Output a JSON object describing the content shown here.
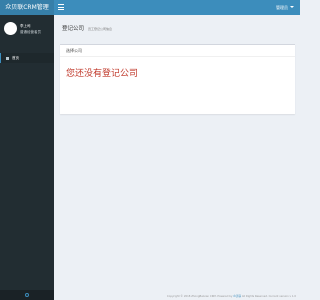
{
  "app": {
    "logo_text": "众贝联CRM管理"
  },
  "sidebar": {
    "user": {
      "name": "李上司",
      "role": "普通经营者员"
    },
    "menu": [
      {
        "label": "首页",
        "icon": "dashboard-icon"
      }
    ],
    "bottom_icon": "power-icon"
  },
  "header": {
    "user_label": "管理员"
  },
  "content": {
    "breadcrumb": {
      "title": "登记公司",
      "subtitle": "员工登记公司信息"
    },
    "box": {
      "title": "选择公司",
      "message": "您还没有登记公司"
    }
  },
  "footer": {
    "prefix": "Copyright © 2018 ZhongBeiLian CRM. Powered by ",
    "link": "众贝联",
    "suffix": "  All Rights Reserved. Current version v 1.0"
  },
  "colors": {
    "sidebar_bg": "#222d32",
    "header_bg": "#3c8dbc",
    "logo_bg": "#367fa9",
    "content_bg": "#ecf0f5",
    "message_color": "#c0392b"
  }
}
